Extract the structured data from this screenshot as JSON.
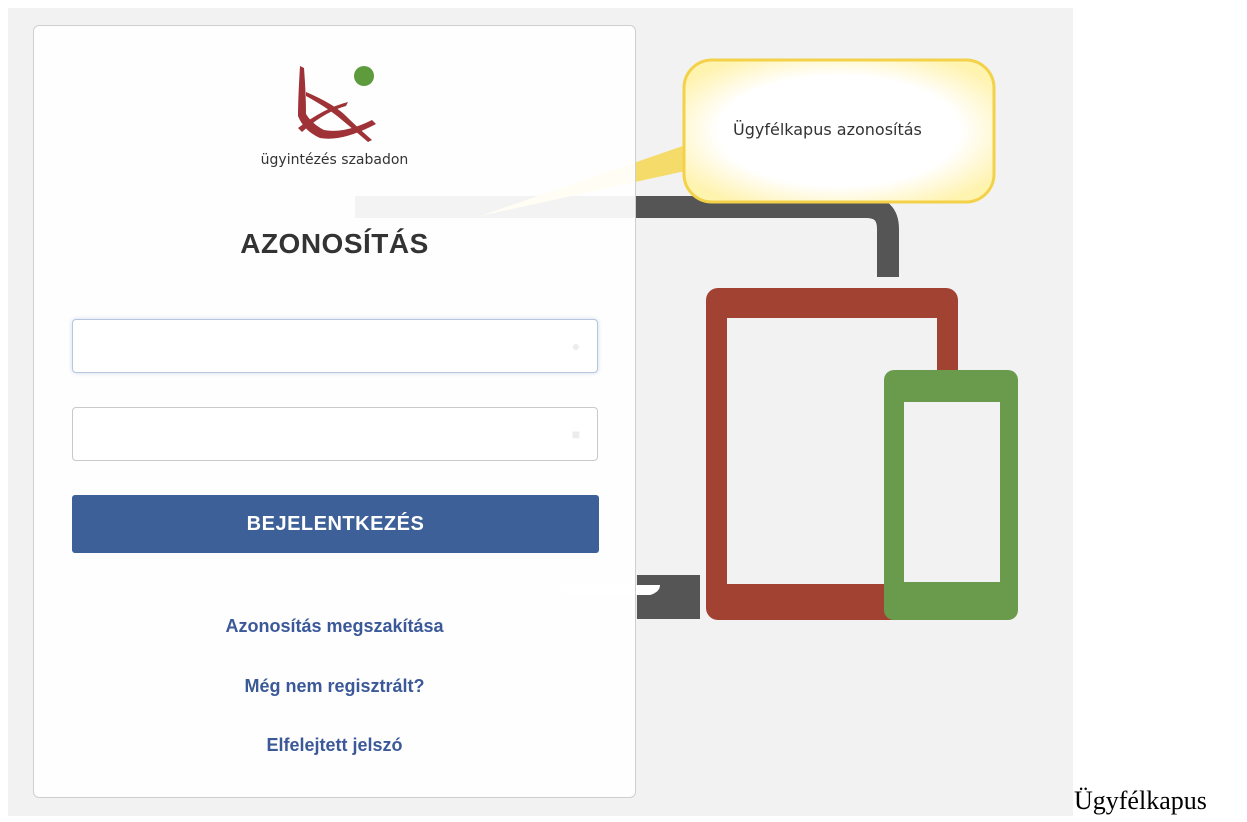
{
  "brand": {
    "tagline": "ügyintézés szabadon",
    "colors": {
      "red": "#9e3237",
      "green": "#5e9b3c"
    }
  },
  "login": {
    "title": "AZONOSÍTÁS",
    "username_placeholder": "",
    "password_placeholder": "",
    "username_icon": "user-icon",
    "password_icon": "lock-icon",
    "submit_label": "BEJELENTKEZÉS",
    "button_color": "#3d6098"
  },
  "links": {
    "cancel": "Azonosítás megszakítása",
    "register": "Még nem regisztrált?",
    "forgot_password": "Elfelejtett jelszó",
    "color": "#3b5998"
  },
  "callout": {
    "text": "Ügyfélkapus azonosítás"
  },
  "illustration": {
    "laptop_color": "#555555",
    "tablet_color": "#a14233",
    "phone_color": "#6a9a4c"
  },
  "caption": "Ügyfélkapus"
}
